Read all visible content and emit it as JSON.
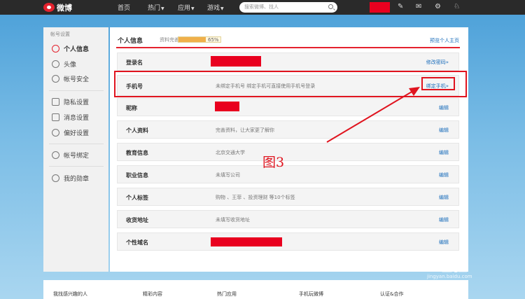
{
  "topnav": {
    "brand": "微博",
    "items": [
      "首页",
      "热门",
      "应用",
      "游戏"
    ],
    "search_placeholder": "搜索微博、找人"
  },
  "sidebar": {
    "section_title": "帐号设置",
    "items": [
      {
        "label": "个人信息",
        "icon": "user-icon"
      },
      {
        "label": "头像",
        "icon": "avatar-icon"
      },
      {
        "label": "帐号安全",
        "icon": "shield-icon"
      },
      {
        "label": "隐私设置",
        "icon": "lock-icon"
      },
      {
        "label": "消息设置",
        "icon": "message-icon"
      },
      {
        "label": "偏好设置",
        "icon": "heart-icon"
      },
      {
        "label": "帐号绑定",
        "icon": "link-user-icon"
      },
      {
        "label": "我的勋章",
        "icon": "medal-icon"
      }
    ]
  },
  "main": {
    "title": "个人信息",
    "completion_label": "资料完善度",
    "completion_percent": "65%",
    "completion_value": 0.65,
    "preview_link": "预览个人主页",
    "rows": [
      {
        "label": "登录名",
        "value": "",
        "action": "修改密码»"
      },
      {
        "label": "手机号",
        "value": "未绑定手机号 绑定手机可直接使用手机号登录",
        "action": "绑定手机»"
      },
      {
        "label": "昵称",
        "value": "",
        "action": "编辑"
      },
      {
        "label": "个人资料",
        "value": "完善资料，让大家更了解你",
        "action": "编辑"
      },
      {
        "label": "教育信息",
        "value": "北京交通大学",
        "action": "编辑"
      },
      {
        "label": "职业信息",
        "value": "未填写公司",
        "action": "编辑"
      },
      {
        "label": "个人标签",
        "value": "购物 、王菲 、投资理财 等10个标签",
        "action": "编辑"
      },
      {
        "label": "收货地址",
        "value": "未填写收货地址",
        "action": "编辑"
      },
      {
        "label": "个性域名",
        "value": "",
        "action": "编辑"
      }
    ]
  },
  "annotation": {
    "label": "图3"
  },
  "footer": {
    "links": [
      "我找感兴趣的人",
      "精彩内容",
      "热门应用",
      "手机玩微博",
      "认证&合作"
    ]
  },
  "watermark": {
    "text": "Bai 经验",
    "sub": "jingyan.baidu.com"
  },
  "colors": {
    "accent_red": "#e0141f",
    "link_blue": "#1a6dbb",
    "redaction": "#e9001f"
  }
}
